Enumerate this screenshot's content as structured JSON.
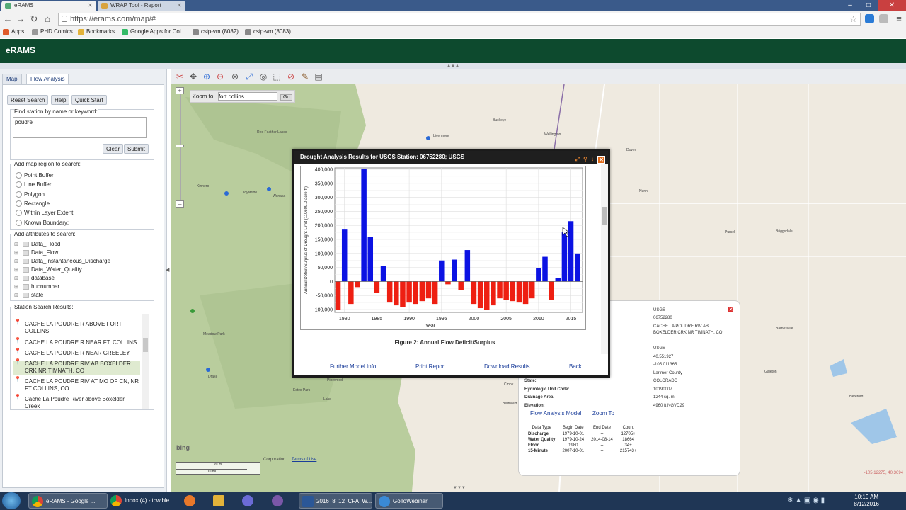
{
  "browser": {
    "tabs": [
      {
        "label": "eRAMS",
        "active": true
      },
      {
        "label": "WRAP Tool - Report",
        "active": false
      }
    ],
    "url": "https://erams.com/map/#",
    "bookmarks": [
      "Apps",
      "PHD Comics",
      "Bookmarks",
      "Google Apps for Col",
      "csip-vm (8082)",
      "csip-vm (8083)"
    ]
  },
  "app": {
    "title": "eRAMS"
  },
  "left_panel": {
    "tabs": [
      "Map",
      "Flow Analysis"
    ],
    "active_tab": "Flow Analysis",
    "buttons": {
      "reset": "Reset Search",
      "help": "Help",
      "quick_start": "Quick Start"
    },
    "search": {
      "label": "Find station by name or keyword:",
      "value": "poudre",
      "clear": "Clear",
      "submit": "Submit"
    },
    "region": {
      "label": "Add map region to search:",
      "options": [
        "Point Buffer",
        "Line Buffer",
        "Polygon",
        "Rectangle",
        "Within Layer Extent",
        "Known Boundary:"
      ]
    },
    "attributes": {
      "label": "Add attributes to search:",
      "items": [
        "Data_Flood",
        "Data_Flow",
        "Data_Instantaneous_Discharge",
        "Data_Water_Quality",
        "database",
        "hucnumber",
        "state"
      ]
    },
    "results": {
      "label": "Station Search Results:",
      "items": [
        "CACHE LA POUDRE R ABOVE FORT COLLINS",
        "CACHE LA POUDRE R NEAR FT. COLLINS",
        "CACHE LA POUDRE R NEAR GREELEY",
        "CACHE LA POUDRE RIV AB BOXELDER CRK NR TIMNATH, CO",
        "CACHE LA POUDRE RIV AT MO OF CN, NR FT COLLINS, CO",
        "Cache La Poudre River above Boxelder Creek"
      ],
      "selected_index": 3
    }
  },
  "map": {
    "zoom_to_label": "Zoom to:",
    "zoom_to_value": "fort collins",
    "go_label": "Go",
    "bing_label": "bing",
    "terms_label": "Terms of Use",
    "attribution": "Corporation",
    "scale_top": "20 mi",
    "scale_bottom": "10 mi",
    "coords": "-105.12275, 40.3694",
    "place_labels": [
      "Red Feather Lakes",
      "Livermore",
      "Buckeye",
      "Wellington",
      "Nunn",
      "Dover",
      "Purcell",
      "Briggsdale",
      "Kinnero",
      "Idylwilde",
      "Wanaka",
      "Estes Park",
      "Pinewood",
      "Lake",
      "Berthoud",
      "Barnesville",
      "Meadow Park",
      "Galeton",
      "Hereford",
      "Drake",
      "Crook"
    ],
    "colors": {
      "map_bg": "#efeae0",
      "forest": "#b9cd9d",
      "road": "#ffffff",
      "water": "#9fc6e8"
    }
  },
  "dialog": {
    "title": "Drought Analysis Results for USGS Station: 06752280; USGS",
    "figure_caption": "Figure 2: Annual Flow Deficit/Surplus",
    "links": [
      "Further Model Info.",
      "Print Report",
      "Download Results",
      "Back"
    ]
  },
  "chart_data": {
    "type": "bar",
    "title": "",
    "xlabel": "Year",
    "ylabel": "Annual Deficit/Surplus of Drought Limit (110609.0 acre-ft)",
    "x": [
      1979,
      1980,
      1981,
      1982,
      1983,
      1984,
      1985,
      1986,
      1987,
      1988,
      1989,
      1990,
      1991,
      1992,
      1993,
      1994,
      1995,
      1996,
      1997,
      1998,
      1999,
      2000,
      2001,
      2002,
      2003,
      2004,
      2005,
      2006,
      2007,
      2008,
      2009,
      2010,
      2011,
      2012,
      2013,
      2014,
      2015,
      2016
    ],
    "values": [
      -100000,
      185000,
      -80000,
      -20000,
      400000,
      158000,
      -40000,
      55000,
      -75000,
      -85000,
      -90000,
      -75000,
      -80000,
      -70000,
      -60000,
      -80000,
      75000,
      -10000,
      78000,
      -30000,
      112000,
      -80000,
      -95000,
      -100000,
      -85000,
      -60000,
      -65000,
      -70000,
      -75000,
      -80000,
      -60000,
      48000,
      88000,
      -65000,
      12000,
      175000,
      215000,
      100000
    ],
    "xticks": [
      1980,
      1985,
      1990,
      1995,
      2000,
      2005,
      2010,
      2015
    ],
    "yticks": [
      400000,
      350000,
      300000,
      250000,
      200000,
      150000,
      100000,
      50000,
      0,
      -50000,
      -100000
    ],
    "ytick_labels": [
      "400,000",
      "350,000",
      "300,000",
      "250,000",
      "200,000",
      "150,000",
      "100,000",
      "50,000",
      "0",
      "-50,000",
      "-100,000"
    ],
    "ylim": [
      -110000,
      405000
    ],
    "xlim": [
      1978.5,
      2016.8
    ],
    "grid": true,
    "colors": {
      "positive": "#0b12e3",
      "negative": "#ee1f12"
    }
  },
  "info_popup": {
    "fields_top": [
      "USGS",
      "06752280",
      "CACHE LA POUDRE RIV AB BOXELDER CRK NR TIMNATH, CO",
      "USGS"
    ],
    "fields_mid": [
      "40.551927",
      "-105.011365",
      "Larimer County",
      "COLORADO"
    ],
    "hydrologic_unit_label": "Hydrologic Unit Code:",
    "hydrologic_unit_value": "10190007",
    "drainage_label": "Drainage Area:",
    "drainage_value": "1244 sq. mi",
    "elevation_label": "Elevation:",
    "elevation_value": "4960 ft NGVD29",
    "state_label": "State:",
    "links": [
      "Flow Analysis Model",
      "Zoom To"
    ],
    "table": {
      "headers": [
        "Data Type",
        "Begin Date",
        "End Date",
        "Count"
      ],
      "rows": [
        [
          "Discharge",
          "1979-10-01",
          "--",
          "12705+"
        ],
        [
          "Water Quality",
          "1979-10-24",
          "2014-08-14",
          "18664"
        ],
        [
          "Flood",
          "1980",
          "--",
          "34+"
        ],
        [
          "15-Minute",
          "2007-10-01",
          "--",
          "215743+"
        ]
      ]
    }
  },
  "taskbar": {
    "items": [
      "eRAMS - Google ...",
      "Inbox (4) - tcwible...",
      "",
      "",
      "",
      "",
      "2016_8_12_CFA_W...",
      "GoToWebinar"
    ],
    "time": "10:19 AM",
    "date": "8/12/2016"
  }
}
